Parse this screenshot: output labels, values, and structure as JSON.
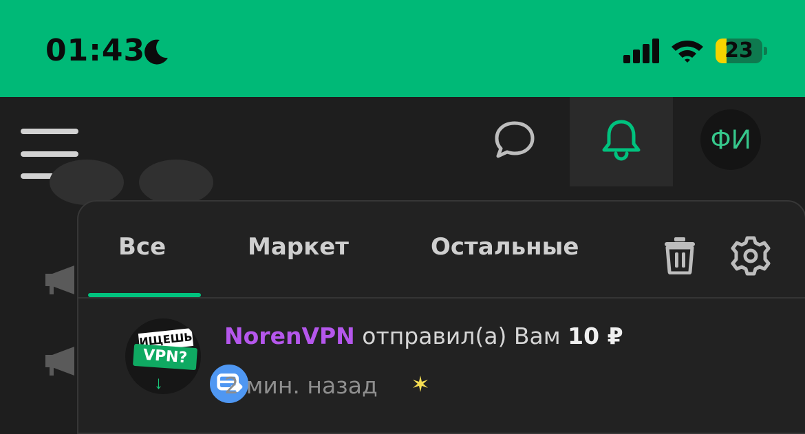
{
  "status_bar": {
    "time": "01:43",
    "battery_level": "23",
    "battery_fraction": 0.23,
    "background_color": "#00b977",
    "icons": [
      "moon-icon",
      "cellular-signal-icon",
      "wifi-icon",
      "battery-icon"
    ]
  },
  "header": {
    "menu_icon": "hamburger-icon",
    "chat_icon": "chat-bubble-icon",
    "bell_icon": "bell-icon",
    "avatar_initials": "ФИ",
    "accent_color": "#00c27e"
  },
  "notifications_panel": {
    "tabs": [
      {
        "label": "Все",
        "active": true
      },
      {
        "label": "Маркет",
        "active": false
      },
      {
        "label": "Остальные",
        "active": false
      }
    ],
    "actions": [
      "trash-icon",
      "gear-icon"
    ],
    "items": [
      {
        "image_text_top": "ИЩЕШЬ",
        "image_text_bottom": "VPN?",
        "sender": "NorenVPN",
        "message": "отправил(а) Вам",
        "amount": "10 ₽",
        "time": "2 мин. назад",
        "badge_icon": "transfer-icon",
        "status_icon": "sparkle-icon",
        "sender_color": "#b557ec"
      }
    ]
  }
}
